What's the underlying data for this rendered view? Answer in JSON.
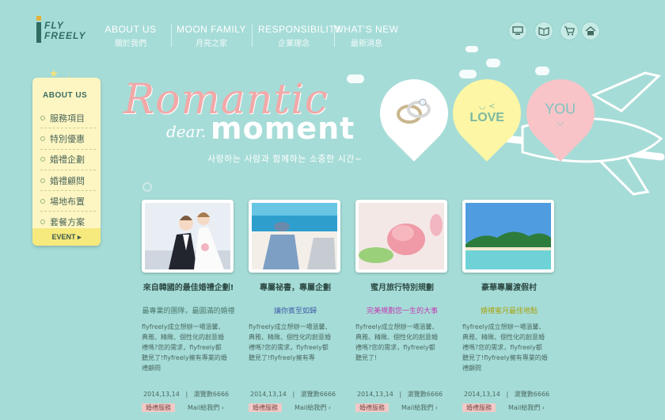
{
  "brand": {
    "line1": "FLY",
    "line2": "FREELY"
  },
  "nav": [
    {
      "en": "ABOUT US",
      "zh": "關於我們"
    },
    {
      "en": "MOON FAMILY",
      "zh": "月亮之家"
    },
    {
      "en": "RESPONSIBILITY",
      "zh": "企業理念"
    },
    {
      "en": "WHAT'S NEW",
      "zh": "最新消息"
    }
  ],
  "header_icons": [
    "computer-icon",
    "book-icon",
    "cart-icon",
    "home-icon"
  ],
  "sidebar": {
    "title": "ABOUT US",
    "items": [
      "服務項目",
      "特別優惠",
      "婚禮企劃",
      "婚禮顧問",
      "場地布置",
      "套餐方案"
    ],
    "event": "EVENT ▸"
  },
  "hero": {
    "title": "Romantic",
    "dear": "dear.",
    "moment": "moment",
    "subtitle": "사랑하는 사람과 함께하는 소중한 시간~",
    "balloon_love": "LOVE",
    "balloon_you": "YOU"
  },
  "cards": [
    {
      "title": "來自韓國的最佳婚禮企劃!",
      "subtitle": "最專業的團隊，最圓滿的婚禮",
      "subtitle_color": "#4b7a6e",
      "desc": "flyfreely成立想辦一場溫馨、典雅、精緻、個性化的創意婚禮嗎?您的需求，flyfreely都聽見了!flyfreely擁有專業的婚禮顧問",
      "date": "2014,13,14",
      "views": "瀏覽數6666",
      "button": "婚禮服務",
      "mail": "Mail給我們 ›"
    },
    {
      "title": "專屬祕書，專屬企劃",
      "subtitle": "讓你賓至如歸",
      "subtitle_color": "#3f5ea8",
      "desc": "flyfreely成立想辦一場溫馨、典雅、精緻、個性化的創意婚禮嗎?您的需求，flyfreely都聽見了!flyfreely擁有專",
      "date": "2014,13,14",
      "views": "瀏覽數6666",
      "button": "婚禮服務",
      "mail": "Mail給我們 ›"
    },
    {
      "title": "蜜月旅行特別規劃",
      "subtitle": "完美規劃您一生的大事",
      "subtitle_color": "#c23ab3",
      "desc": "flyfreely成立想辦一場溫馨、典雅、精緻、個性化的創意婚禮嗎?您的需求，flyfreely都聽見了!",
      "date": "2014,13,14",
      "views": "瀏覽數6666",
      "button": "婚禮服務",
      "mail": "Mail給我們 ›"
    },
    {
      "title": "豪華專屬渡假村",
      "subtitle": "婚禮蜜月最佳地點",
      "subtitle_color": "#a8a313",
      "desc": "flyfreely成立想辦一場溫馨、典雅、精緻、個性化的創意婚禮嗎?您的需求，flyfreely都聽見了!flyfreely擁有專業的婚禮顧問",
      "date": "2014,13,14",
      "views": "瀏覽數6666",
      "button": "婚禮服務",
      "mail": "Mail給我們 ›"
    }
  ],
  "colors": {
    "background": "#a6dcd7",
    "sidebar": "#fdf6c3",
    "accent_pink": "#f3a8a8"
  }
}
